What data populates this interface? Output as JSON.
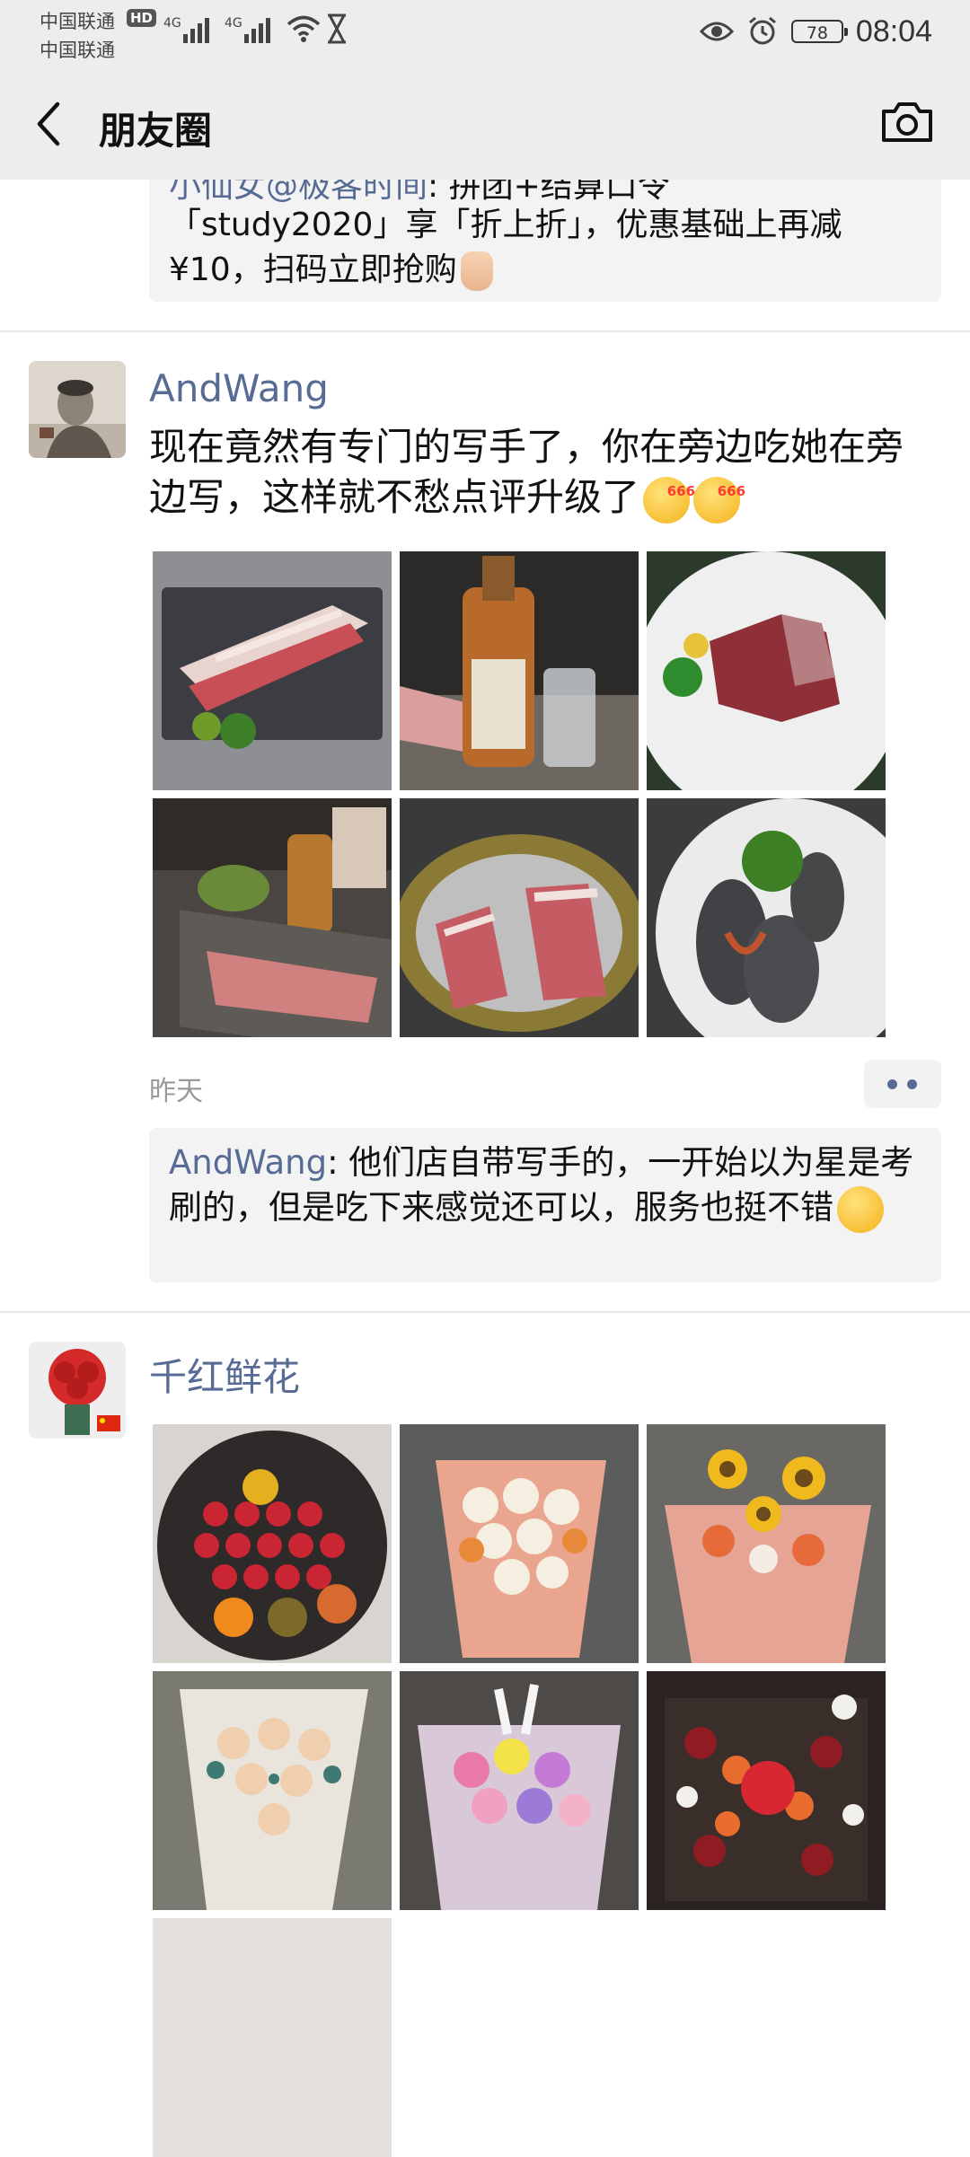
{
  "status_bar": {
    "carrier_1": "中国联通",
    "carrier_2": "中国联通",
    "hd": "HD",
    "net_1": "4G",
    "net_2": "4G",
    "battery": "78",
    "time": "08:04"
  },
  "nav": {
    "title": "朋友圈",
    "back_icon": "chevron-left-icon",
    "camera_icon": "camera-icon"
  },
  "partial_post": {
    "comment_top_name": "小仙女@极客时间",
    "comment_top_text": ": 拼团+结算口令",
    "comment_body": "「study2020」享「折上折」，优惠基础上再减 ¥10，扫码立即抢购"
  },
  "posts": [
    {
      "author": "AndWang",
      "text": "现在竟然有专门的写手了，你在旁边吃她在旁边写，这样就不愁点评升级了",
      "emoji_tag": "666",
      "time": "昨天",
      "comment": {
        "name": "AndWang",
        "text": ": 他们店自带写手的，一开始以为星是考刷的，但是吃下来感觉还可以，服务也挺不错"
      }
    },
    {
      "author": "千红鲜花"
    }
  ],
  "colors": {
    "link": "#576b95",
    "nav_bg": "#ededed",
    "comment_bg": "#f3f3f3"
  }
}
